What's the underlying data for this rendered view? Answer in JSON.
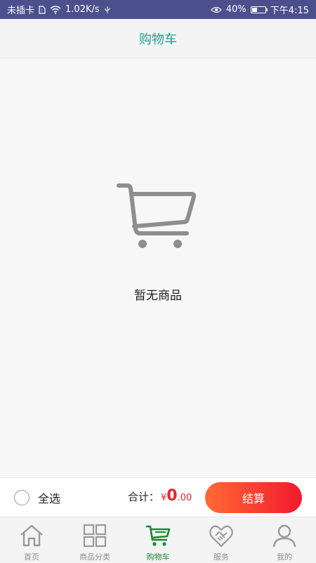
{
  "statusbar": {
    "carrier": "未插卡",
    "speed": "1.02K/s",
    "battery": "40%",
    "battery_level": 0.4,
    "time": "下午4:15"
  },
  "header": {
    "title": "购物车"
  },
  "empty_state": {
    "message": "暂无商品",
    "icon": "cart-icon"
  },
  "checkout": {
    "select_all_label": "全选",
    "total_label": "合计：",
    "currency": "¥",
    "total_integer": "0",
    "total_decimal": ".00",
    "checkout_label": "结算"
  },
  "tabs": [
    {
      "label": "首页",
      "icon": "home-icon",
      "active": false
    },
    {
      "label": "商品分类",
      "icon": "grid-icon",
      "active": false
    },
    {
      "label": "购物车",
      "icon": "cart-icon",
      "active": true
    },
    {
      "label": "服务",
      "icon": "handshake-icon",
      "active": false
    },
    {
      "label": "我的",
      "icon": "person-icon",
      "active": false
    }
  ],
  "colors": {
    "statusbar": "#4b4f8c",
    "accent_title": "#1aa291",
    "active_tab": "#1b8a2f",
    "price": "#e8242a",
    "button_gradient_start": "#ff6a35",
    "button_gradient_end": "#f2192d"
  }
}
